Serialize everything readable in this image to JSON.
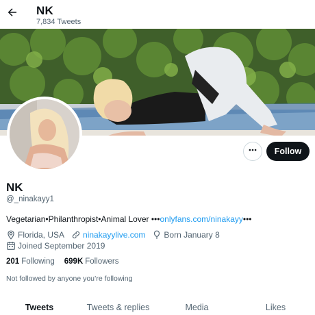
{
  "header": {
    "title": "NK",
    "tweet_count": "7,834 Tweets"
  },
  "icons": {
    "back": "arrow-left-icon",
    "more": "more-horizontal-icon",
    "location": "location-pin-icon",
    "link": "link-icon",
    "birthday": "balloon-icon",
    "calendar": "calendar-icon"
  },
  "profile": {
    "display_name": "NK",
    "handle": "@_ninakayy1",
    "follow_label": "Follow",
    "bio_text": "Vegetarian•Philanthropist•Animal Lover •••",
    "bio_link": "onlyfans.com/ninakayy",
    "bio_suffix": "•••",
    "location": "Florida, USA",
    "website": "ninakayylive.com",
    "birthday": "Born January 8",
    "joined": "Joined September 2019",
    "following_count": "201",
    "following_label": "Following",
    "followers_count": "699K",
    "followers_label": "Followers",
    "followed_note": "Not followed by anyone you’re following"
  },
  "tabs": [
    {
      "label": "Tweets",
      "active": true
    },
    {
      "label": "Tweets & replies",
      "active": false
    },
    {
      "label": "Media",
      "active": false
    },
    {
      "label": "Likes",
      "active": false
    }
  ],
  "colors": {
    "accent": "#1d9bf0",
    "text": "#0f1419",
    "muted": "#536471",
    "button_dark": "#0f1419"
  }
}
